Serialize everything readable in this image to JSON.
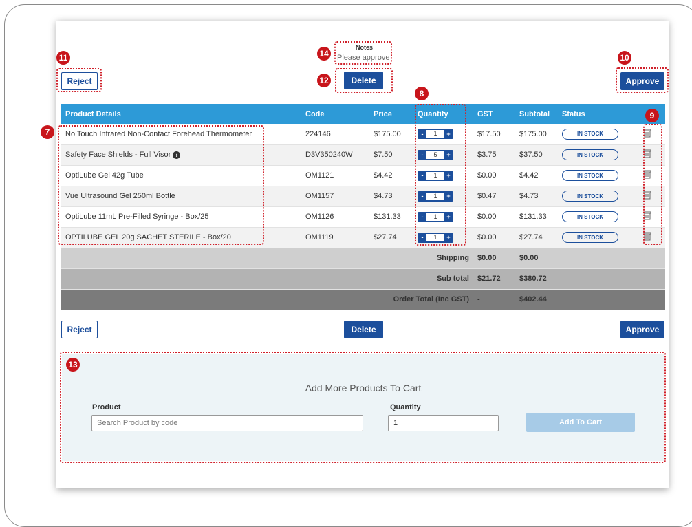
{
  "notes": {
    "label": "Notes",
    "text": "Please approve"
  },
  "buttons": {
    "reject": "Reject",
    "delete": "Delete",
    "approve": "Approve"
  },
  "table": {
    "headers": [
      "Product Details",
      "Code",
      "Price",
      "Quantity",
      "GST",
      "Subtotal",
      "Status"
    ],
    "rows": [
      {
        "product": "No Touch Infrared Non-Contact Forehead Thermometer",
        "code": "224146",
        "price": "$175.00",
        "qty": "1",
        "gst": "$17.50",
        "subtotal": "$175.00",
        "status": "IN STOCK"
      },
      {
        "product": "Safety Face Shields - Full Visor",
        "code": "D3V350240W",
        "price": "$7.50",
        "qty": "5",
        "gst": "$3.75",
        "subtotal": "$37.50",
        "status": "IN STOCK"
      },
      {
        "product": "OptiLube Gel 42g Tube",
        "code": "OM1121",
        "price": "$4.42",
        "qty": "1",
        "gst": "$0.00",
        "subtotal": "$4.42",
        "status": "IN STOCK"
      },
      {
        "product": "Vue Ultrasound Gel 250ml Bottle",
        "code": "OM1157",
        "price": "$4.73",
        "qty": "1",
        "gst": "$0.47",
        "subtotal": "$4.73",
        "status": "IN STOCK"
      },
      {
        "product": "OptiLube 11mL Pre-Filled Syringe - Box/25",
        "code": "OM1126",
        "price": "$131.33",
        "qty": "1",
        "gst": "$0.00",
        "subtotal": "$131.33",
        "status": "IN STOCK"
      },
      {
        "product": "OPTILUBE GEL 20g SACHET STERILE - Box/20",
        "code": "OM1119",
        "price": "$27.74",
        "qty": "1",
        "gst": "$0.00",
        "subtotal": "$27.74",
        "status": "IN STOCK"
      }
    ],
    "qty_minus": "-",
    "qty_plus": "+",
    "info_icon": "i",
    "summary": {
      "shipping": {
        "label": "Shipping",
        "gst": "$0.00",
        "subtotal": "$0.00"
      },
      "subtotal": {
        "label": "Sub total",
        "gst": "$21.72",
        "subtotal": "$380.72"
      },
      "total": {
        "label": "Order Total (Inc GST)",
        "gst": "-",
        "subtotal": "$402.44"
      }
    }
  },
  "add_products": {
    "title": "Add More Products To Cart",
    "product_label": "Product",
    "product_placeholder": "Search Product by code",
    "quantity_label": "Quantity",
    "quantity_value": "1",
    "button": "Add To Cart"
  },
  "callouts": {
    "b7": "7",
    "b8": "8",
    "b9": "9",
    "b10": "10",
    "b11": "11",
    "b12": "12",
    "b13": "13",
    "b14": "14"
  },
  "colors": {
    "header_blue": "#2d9ad7",
    "button_blue": "#1c4f9c",
    "callout_red": "#c8151b"
  }
}
